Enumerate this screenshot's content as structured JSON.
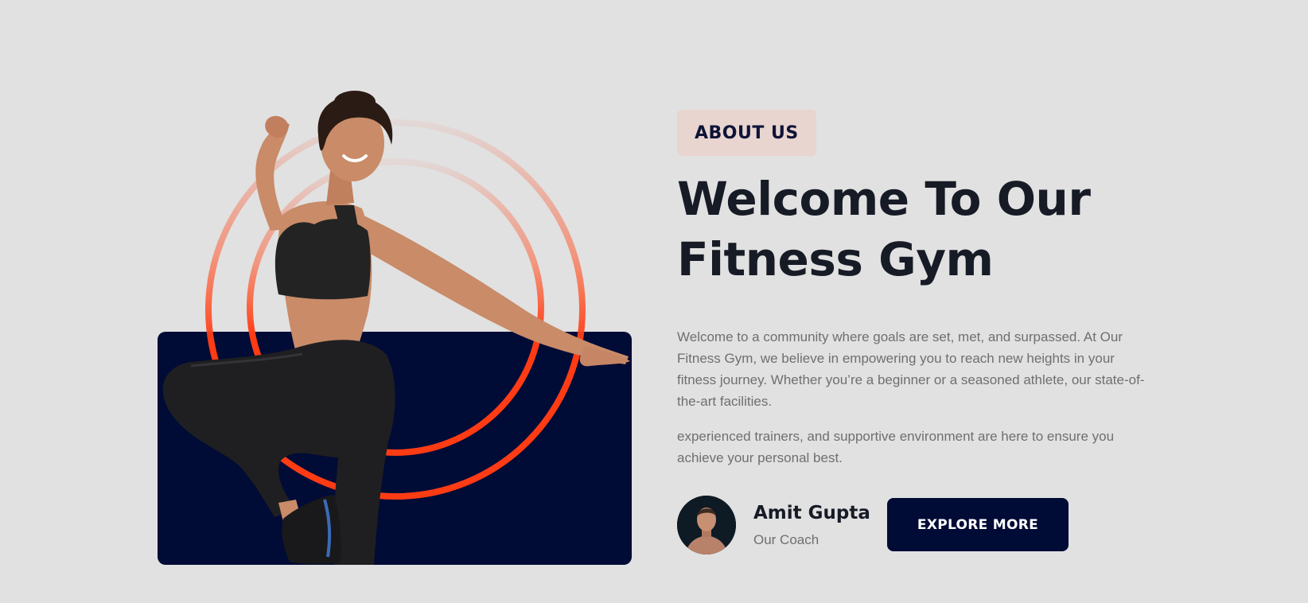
{
  "about": {
    "badge": "ABOUT US",
    "title_line_1": "Welcome To Our",
    "title_line_2": "Fitness Gym",
    "paragraph_1": "Welcome to a community where goals are set, met, and surpassed. At Our Fitness Gym, we believe in empowering you to reach new heights in your fitness journey. Whether you’re a beginner or a seasoned athlete, our state-of-the-art facilities.",
    "paragraph_2": "experienced trainers, and supportive environment are here to ensure you achieve your personal best."
  },
  "coach": {
    "name": "Amit Gupta",
    "role": "Our Coach"
  },
  "cta": {
    "label": "EXPLORE MORE"
  },
  "colors": {
    "background": "#e1e1e1",
    "navy": "#000b36",
    "accent_orange": "#ff3b14",
    "badge_bg": "#e8d5cf",
    "heading": "#161b26",
    "body_text": "#6f6f72"
  }
}
